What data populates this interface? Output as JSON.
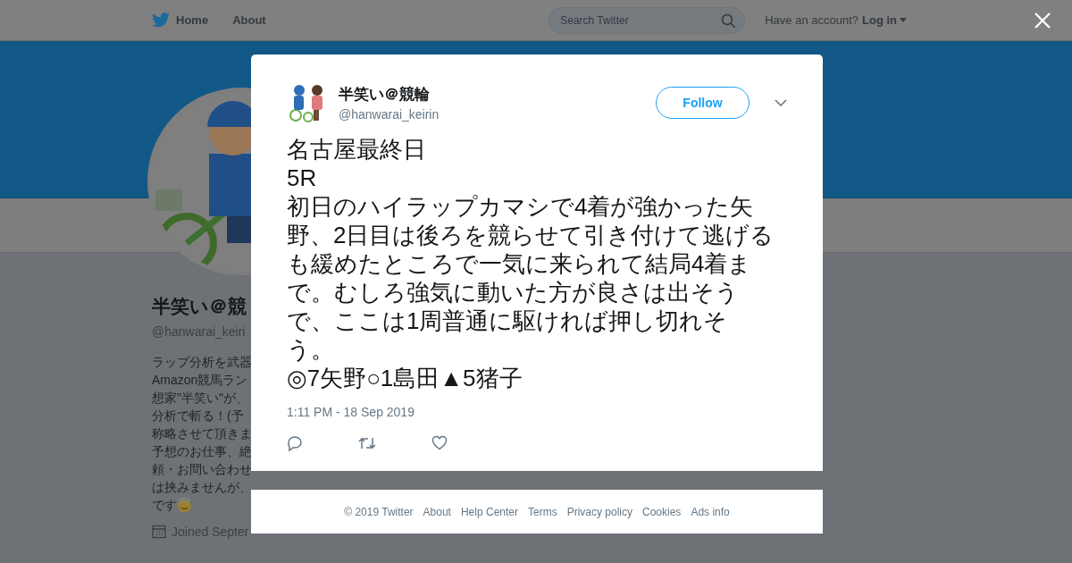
{
  "topbar": {
    "nav": [
      {
        "label": "Home",
        "kind": "home"
      },
      {
        "label": "About",
        "kind": "plain"
      }
    ],
    "search": {
      "placeholder": "Search Twitter"
    },
    "account_prompt": "Have an account?",
    "login": "Log in"
  },
  "profile": {
    "name": "半笑い＠競",
    "handle": "@hanwarai_keiri",
    "bio_lines": [
      "ラップ分析を武器",
      "Amazon競馬ラン",
      "想家\"半笑い\"が、",
      "分析で斬る！(予",
      "称略させて頂きま",
      "予想のお仕事、絶",
      "頼・お問い合わせ",
      "は挟みませんが、",
      "です"
    ],
    "joined": "Joined Septer"
  },
  "tweet": {
    "name": "半笑い＠競輪",
    "handle": "@hanwarai_keirin",
    "follow": "Follow",
    "text": "名古屋最終日\n5R\n初日のハイラップカマシで4着が強かった矢野、2日目は後ろを競らせて引き付けて逃げるも緩めたところで一気に来られて結局4着まで。むしろ強気に動いた方が良さは出そうで、ここは1周普通に駆ければ押し切れそう。\n◎7矢野○1島田▲5猪子",
    "time": "1:11 PM - 18 Sep 2019"
  },
  "footer": {
    "links": [
      "© 2019 Twitter",
      "About",
      "Help Center",
      "Terms",
      "Privacy policy",
      "Cookies",
      "Ads info"
    ]
  }
}
